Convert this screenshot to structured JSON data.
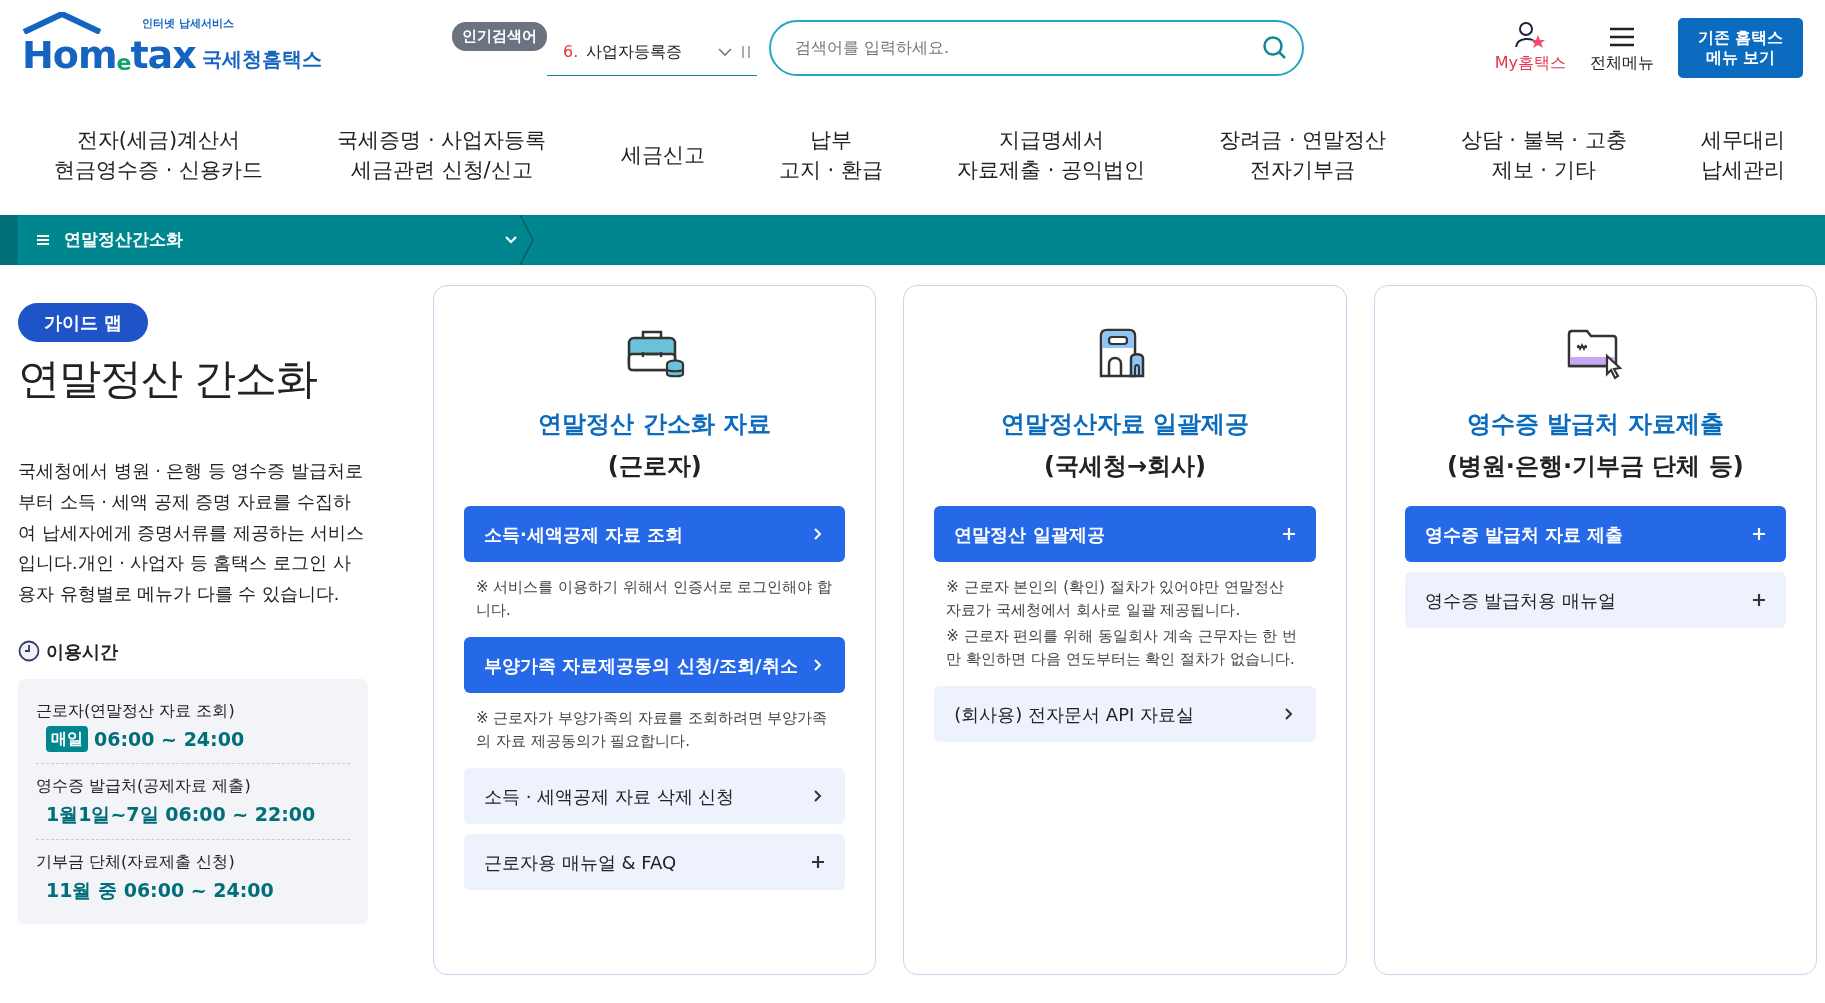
{
  "header": {
    "logo": {
      "tagline": "인터넷 납세서비스",
      "brand": "Hom$_{e}$tax",
      "name": "국세청홈택스"
    },
    "popular_search": {
      "badge": "인기검색어",
      "rank": "6.",
      "term": "사업자등록증"
    },
    "search": {
      "placeholder": "검색어를 입력하세요."
    },
    "utilities": [
      {
        "kind": "user",
        "label": "My홈택스"
      },
      {
        "kind": "menu",
        "label": "전체메뉴"
      }
    ],
    "legacy_button": [
      "기존 홈택스",
      "메뉴 보기"
    ]
  },
  "nav": [
    {
      "lines": [
        "전자(세금)계산서",
        "현금영수증 · 신용카드"
      ]
    },
    {
      "lines": [
        "국세증명 · 사업자등록",
        "세금관련 신청/신고"
      ]
    },
    {
      "lines": [
        "세금신고"
      ]
    },
    {
      "lines": [
        "납부",
        "고지 · 환급"
      ]
    },
    {
      "lines": [
        "지급명세서",
        "자료제출 · 공익법인"
      ]
    },
    {
      "lines": [
        "장려금 · 연말정산",
        "전자기부금"
      ]
    },
    {
      "lines": [
        "상담 · 불복 · 고충",
        "제보 · 기타"
      ]
    },
    {
      "lines": [
        "세무대리",
        "납세관리"
      ]
    }
  ],
  "breadcrumb": {
    "label": "연말정산간소화"
  },
  "guide": {
    "badge": "가이드 맵",
    "title": "연말정산 간소화",
    "description": "국세청에서 병원 · 은행 등 영수증 발급처로부터 소득 · 세액 공제 증명 자료를 수집하여 납세자에게 증명서류를 제공하는 서비스입니다.개인 · 사업자 등 홈택스 로그인 사용자 유형별로 메뉴가 다를 수 있습니다.",
    "hours_title": "이용시간",
    "hours": [
      {
        "label": "근로자(연말정산 자료 조회)",
        "badge": "매일",
        "time": "06:00 ~ 24:00"
      },
      {
        "label": "영수증 발급처(공제자료 제출)",
        "time": "1월1일~7일 06:00 ~ 22:00"
      },
      {
        "label": "기부금 단체(자료제출 신청)",
        "time": "11월 중 06:00 ~ 24:00"
      }
    ]
  },
  "cards": [
    {
      "kind": "briefcase",
      "title": "연말정산 간소화 자료",
      "subtitle": "(근로자)",
      "blocks": [
        {
          "kind": "primary",
          "label": "소득·세액공제 자료 조회",
          "expandable": false
        },
        {
          "kind": "note",
          "lines": [
            "※ 서비스를 이용하기 위해서 인증서로 로그인해야 합니다."
          ]
        },
        {
          "kind": "primary",
          "label": "부양가족 자료제공동의 신청/조회/취소",
          "expandable": false
        },
        {
          "kind": "note",
          "lines": [
            "※ 근로자가 부양가족의 자료를 조회하려면 부양가족의 자료 제공동의가 필요합니다."
          ]
        },
        {
          "kind": "secondary",
          "label": "소득 · 세액공제 자료 삭제 신청",
          "expandable": false
        },
        {
          "kind": "secondary",
          "label": "근로자용 매뉴얼 & FAQ",
          "expandable": true
        }
      ]
    },
    {
      "kind": "building",
      "title": "연말정산자료 일괄제공",
      "subtitle": "(국세청→회사)",
      "blocks": [
        {
          "kind": "primary",
          "label": "연말정산 일괄제공",
          "expandable": true
        },
        {
          "kind": "note",
          "lines": [
            "※ 근로자 본인의 (확인) 절차가 있어야만 연말정산 자료가 국세청에서 회사로 일괄 제공됩니다.",
            "※ 근로자 편의를 위해 동일회사 계속 근무자는 한 번만 확인하면 다음 연도부터는 확인 절차가 없습니다."
          ]
        },
        {
          "kind": "secondary",
          "label": "(회사용) 전자문서 API 자료실",
          "expandable": false
        }
      ]
    },
    {
      "kind": "folder",
      "title": "영수증 발급처 자료제출",
      "subtitle": "(병원·은행·기부금 단체 등)",
      "blocks": [
        {
          "kind": "primary",
          "label": "영수증 발급처 자료 제출",
          "expandable": true
        },
        {
          "kind": "secondary",
          "label": "영수증 발급처용 매뉴얼",
          "expandable": true
        }
      ]
    }
  ]
}
